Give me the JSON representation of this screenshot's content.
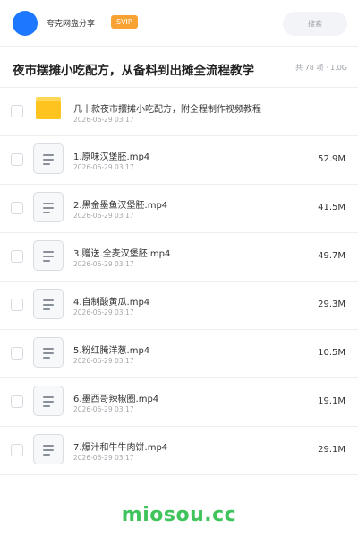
{
  "header": {
    "share_name": "夸克网盘分享",
    "badge": "SVIP",
    "search_placeholder": "搜索"
  },
  "folder_title": "夜市摆摊小吃配方，从备料到出摊全流程教学",
  "meta": "共 78 项 · 1.0G",
  "items": [
    {
      "name": "几十款夜市摆摊小吃配方，附全程制作视频教程",
      "date": "2026-06-29 03:17",
      "size": "",
      "type": "folder"
    },
    {
      "name": "1.原味汉堡胚.mp4",
      "date": "2026-06-29 03:17",
      "size": "52.9M",
      "type": "file"
    },
    {
      "name": "2.黑金墨鱼汉堡胚.mp4",
      "date": "2026-06-29 03:17",
      "size": "41.5M",
      "type": "file"
    },
    {
      "name": "3.赠送.全麦汉堡胚.mp4",
      "date": "2026-06-29 03:17",
      "size": "49.7M",
      "type": "file"
    },
    {
      "name": "4.自制酸黄瓜.mp4",
      "date": "2026-06-29 03:17",
      "size": "29.3M",
      "type": "file"
    },
    {
      "name": "5.粉红腌洋葱.mp4",
      "date": "2026-06-29 03:17",
      "size": "10.5M",
      "type": "file"
    },
    {
      "name": "6.墨西哥辣椒圈.mp4",
      "date": "2026-06-29 03:17",
      "size": "19.1M",
      "type": "file"
    },
    {
      "name": "7.爆汁和牛牛肉饼.mp4",
      "date": "2026-06-29 03:17",
      "size": "29.1M",
      "type": "file"
    }
  ],
  "colors": {
    "avatar": "#1e78ff",
    "badge": "#f7a233",
    "folder": "#ffc31f",
    "watermark": "#3ec45a"
  },
  "icons": {
    "folder": "folder-icon",
    "file": "document-icon"
  },
  "watermark": "miosou.cc"
}
